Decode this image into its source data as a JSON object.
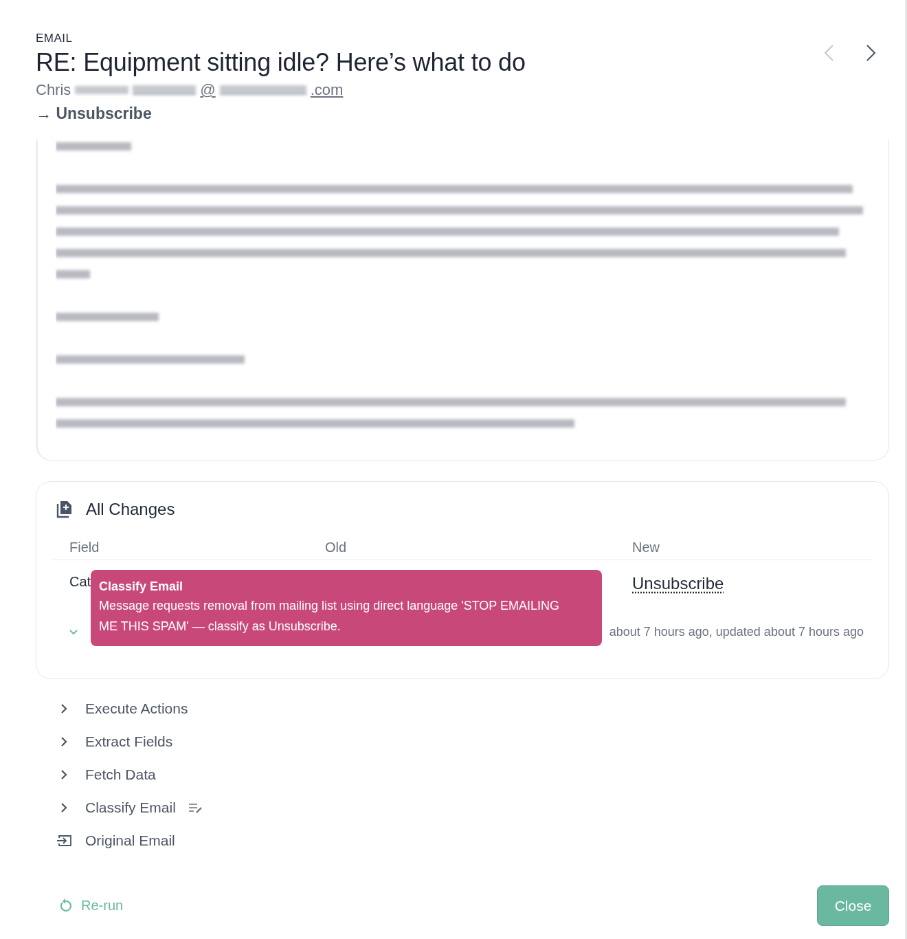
{
  "header": {
    "eyebrow": "EMAIL",
    "title": "RE: Equipment sitting idle? Here’s what to do",
    "sender": {
      "name": "Chris",
      "email_parts": [
        "@",
        ".com"
      ]
    },
    "classification": {
      "arrow": "→",
      "label": "Unsubscribe"
    }
  },
  "nav": {
    "prev_disabled": true,
    "next_disabled": false
  },
  "changes": {
    "title": "All Changes",
    "columns": [
      "Field",
      "Old",
      "New"
    ],
    "rows": [
      {
        "field": "Cat",
        "new": "Unsubscribe"
      }
    ],
    "timestamps": "about 7 hours ago, updated about 7 hours ago",
    "tooltip": {
      "title": "Classify Email",
      "text": "Message requests removal from mailing list using direct language 'STOP EMAILING ME THIS SPAM' — classify as Unsubscribe."
    }
  },
  "steps": [
    {
      "label": "Execute Actions",
      "kind": "expandable",
      "edited": false
    },
    {
      "label": "Extract Fields",
      "kind": "expandable",
      "edited": false
    },
    {
      "label": "Fetch Data",
      "kind": "expandable",
      "edited": false
    },
    {
      "label": "Classify Email",
      "kind": "expandable",
      "edited": true
    },
    {
      "label": "Original Email",
      "kind": "source",
      "edited": false
    }
  ],
  "footer": {
    "rerun": "Re-run",
    "close": "Close"
  }
}
